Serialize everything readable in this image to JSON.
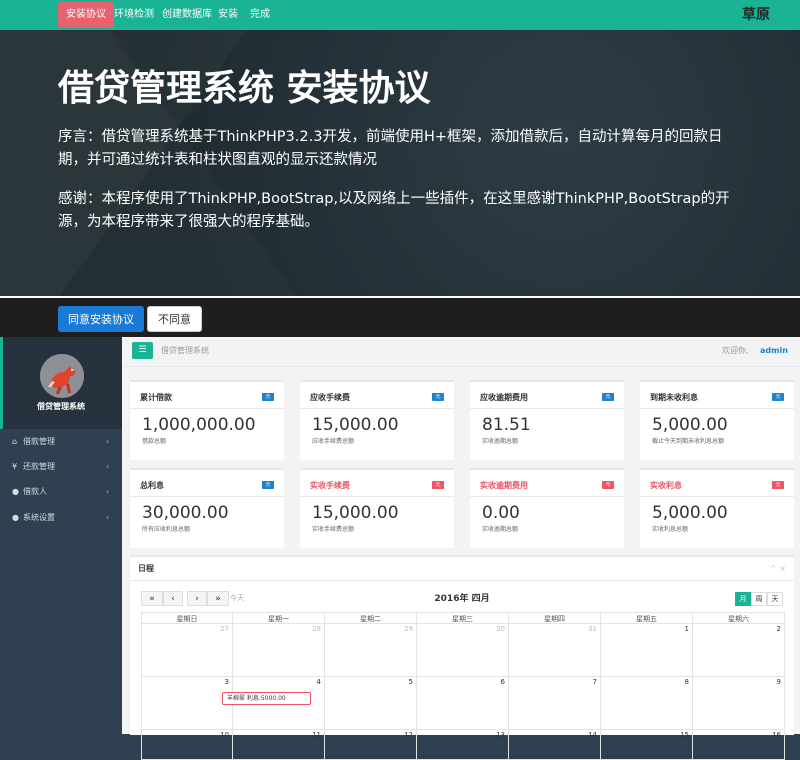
{
  "nav": {
    "tabs": [
      "安装协议",
      "环境检测",
      "创建数据库",
      "安装",
      "完成"
    ],
    "brand": "草原"
  },
  "hero": {
    "title": "借贷管理系统 安装协议",
    "preface": "序言：借贷管理系统基于ThinkPHP3.2.3开发，前端使用H+框架，添加借款后，自动计算每月的回款日期，并可通过统计表和柱状图直观的显示还款情况",
    "thanks": "感谢：本程序使用了ThinkPHP,BootStrap,以及网络上一些插件，在这里感谢ThinkPHP,BootStrap的开源，为本程序带来了很强大的程序基础。"
  },
  "buttons": {
    "agree": "同意安装协议",
    "disagree": "不同意"
  },
  "sidebar": {
    "profile_name": "借贷管理系统",
    "items": [
      {
        "icon": "⌂",
        "label": "借款管理",
        "arrow": "‹"
      },
      {
        "icon": "¥",
        "label": "还款管理",
        "arrow": "‹"
      },
      {
        "icon": "●",
        "label": "借款人",
        "arrow": "‹"
      },
      {
        "icon": "●",
        "label": "系统设置",
        "arrow": "‹"
      }
    ]
  },
  "header": {
    "title": "借贷管理系统",
    "welcome": "欢迎你,",
    "user": "admin"
  },
  "cards": [
    {
      "title": "累计借款",
      "badge": "元",
      "value": "1,000,000.00",
      "sub": "借款总额",
      "accent": "blue"
    },
    {
      "title": "应收手续费",
      "badge": "元",
      "value": "15,000.00",
      "sub": "应收手续费总额",
      "accent": "blue"
    },
    {
      "title": "应收逾期费用",
      "badge": "元",
      "value": "81.51",
      "sub": "实收逾期总额",
      "accent": "blue"
    },
    {
      "title": "到期未收利息",
      "badge": "元",
      "value": "5,000.00",
      "sub": "截止今天到期未收利息总额",
      "accent": "blue"
    },
    {
      "title": "总利息",
      "badge": "元",
      "value": "30,000.00",
      "sub": "所有应收利息总额",
      "accent": "blue"
    },
    {
      "title": "实收手续费",
      "badge": "元",
      "value": "15,000.00",
      "sub": "实收手续费总额",
      "accent": "red"
    },
    {
      "title": "实收逾期费用",
      "badge": "元",
      "value": "0.00",
      "sub": "实收逾期总额",
      "accent": "red"
    },
    {
      "title": "实收利息",
      "badge": "元",
      "value": "5,000.00",
      "sub": "实收利息总额",
      "accent": "red"
    }
  ],
  "calendar": {
    "panel_title": "日程",
    "tools": "^ ×",
    "prev_year": "«",
    "prev": "‹",
    "next": "›",
    "next_year": "»",
    "today": "今天",
    "title": "2016年 四月",
    "views": [
      "月",
      "周",
      "天"
    ],
    "weekdays": [
      "星期日",
      "星期一",
      "星期二",
      "星期三",
      "星期四",
      "星期五",
      "星期六"
    ],
    "weeks": [
      [
        "27",
        "28",
        "29",
        "30",
        "31",
        "1",
        "2"
      ],
      [
        "3",
        "4",
        "5",
        "6",
        "7",
        "8",
        "9"
      ],
      [
        "10",
        "11",
        "12",
        "13",
        "14",
        "15",
        "16"
      ]
    ],
    "event": "羊柳翠 利息:5000.00"
  },
  "colors": {
    "nav": "#1ab394",
    "active_tab": "#e8616f",
    "agree_button": "#1a7bd6",
    "sidebar": "#2f4050",
    "badge_blue": "#1c84c6",
    "badge_red": "#ed5565"
  }
}
